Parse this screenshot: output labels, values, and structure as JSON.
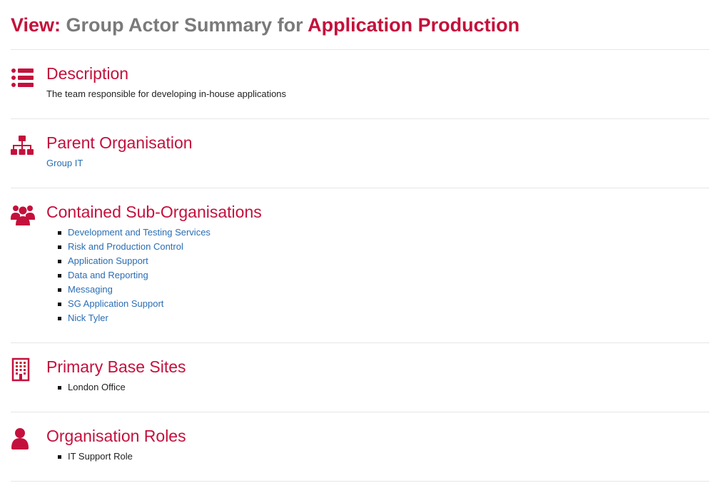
{
  "header": {
    "prefix": "View:",
    "middle": "Group Actor Summary for",
    "subject": "Application Production"
  },
  "sections": {
    "description": {
      "title": "Description",
      "text": "The team responsible for developing in-house applications",
      "icon": "list-icon"
    },
    "parent": {
      "title": "Parent Organisation",
      "link": "Group IT",
      "icon": "org-chart-icon"
    },
    "sub_orgs": {
      "title": "Contained Sub-Organisations",
      "icon": "group-icon",
      "items": [
        "Development and Testing Services",
        "Risk and Production Control",
        "Application Support",
        "Data and Reporting",
        "Messaging",
        "SG Application Support",
        "Nick Tyler"
      ]
    },
    "sites": {
      "title": "Primary Base Sites",
      "icon": "building-icon",
      "items": [
        "London Office"
      ]
    },
    "roles": {
      "title": "Organisation Roles",
      "icon": "user-icon",
      "items": [
        "IT Support Role"
      ]
    }
  },
  "colors": {
    "accent": "#c4103c",
    "link": "#2a6db3",
    "muted": "#7a7a7a"
  }
}
